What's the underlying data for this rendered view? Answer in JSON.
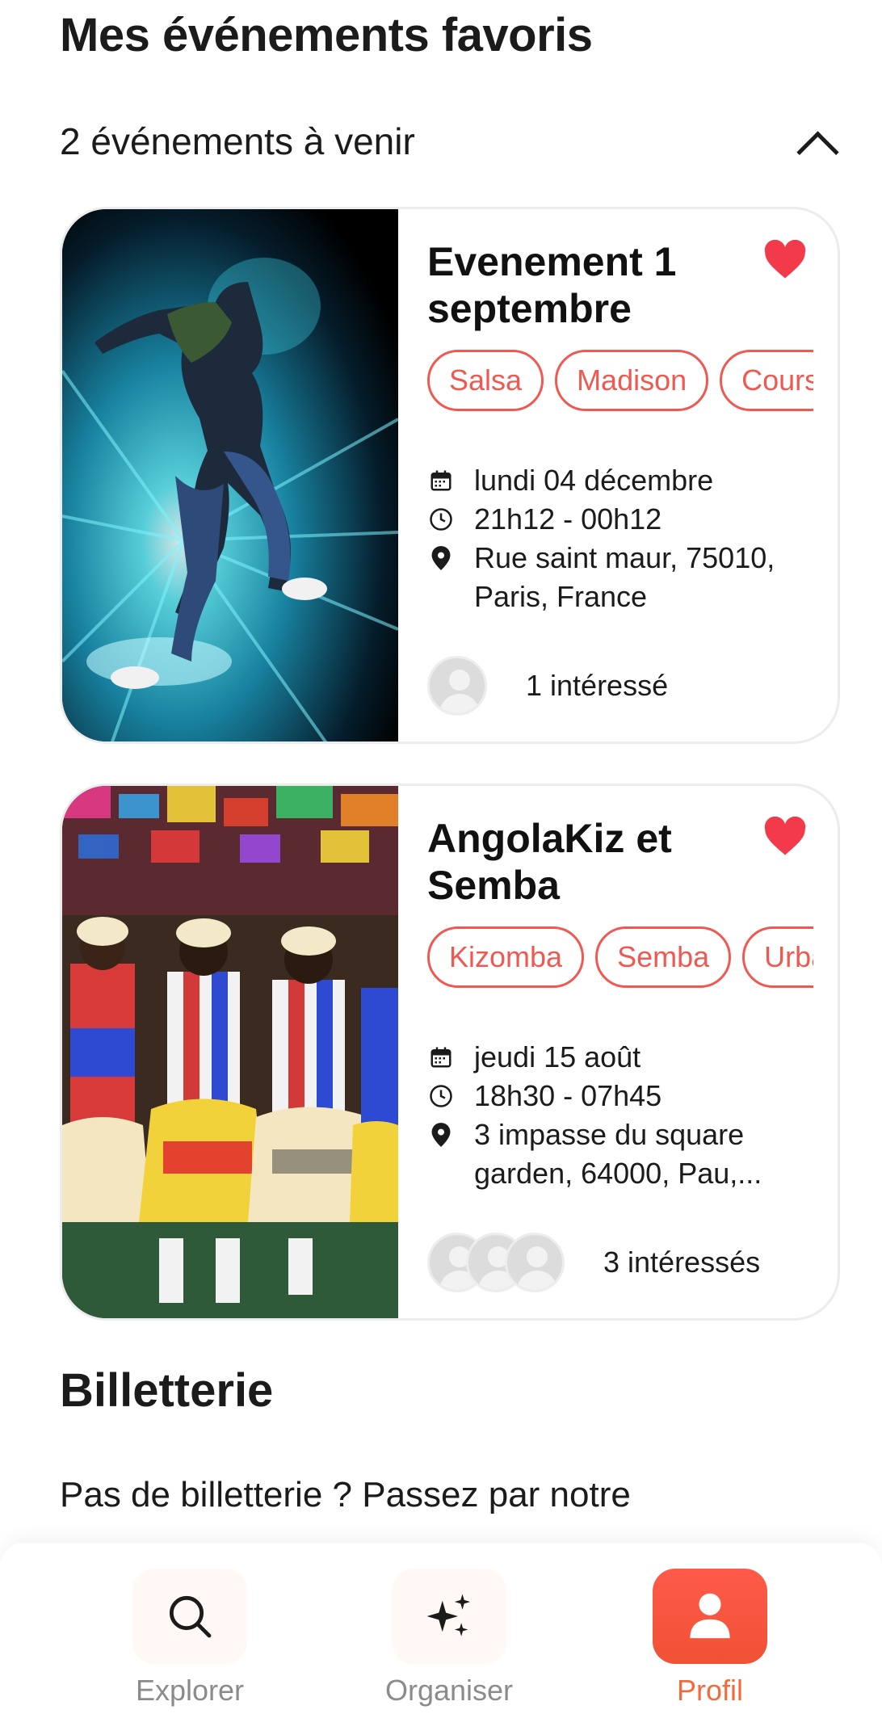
{
  "page": {
    "title": "Mes événements favoris"
  },
  "favorites": {
    "count_label": "2 événements à venir",
    "events": [
      {
        "title": "Evenement 1 septembre",
        "tags": [
          "Salsa",
          "Madison",
          "Cours"
        ],
        "date": "lundi 04 décembre",
        "time": "21h12 - 00h12",
        "address": "Rue saint maur, 75010, Paris, France",
        "interested": "1 intéressé"
      },
      {
        "title": "AngolaKiz et Semba",
        "tags": [
          "Kizomba",
          "Semba",
          "Urbain"
        ],
        "date": "jeudi 15 août",
        "time": "18h30 - 07h45",
        "address": "3 impasse du square garden, 64000, Pau,...",
        "interested": "3 intéressés"
      }
    ]
  },
  "billetterie": {
    "title": "Billetterie",
    "text": "Pas de billetterie ? Passez par notre"
  },
  "nav": {
    "items": [
      {
        "label": "Explorer",
        "icon": "search-icon"
      },
      {
        "label": "Organiser",
        "icon": "sparkles-icon"
      },
      {
        "label": "Profil",
        "icon": "user-icon",
        "active": true
      }
    ]
  },
  "colors": {
    "accent": "#ee5a52",
    "heart": "#f23a4a",
    "nav_active": "#f05235"
  }
}
